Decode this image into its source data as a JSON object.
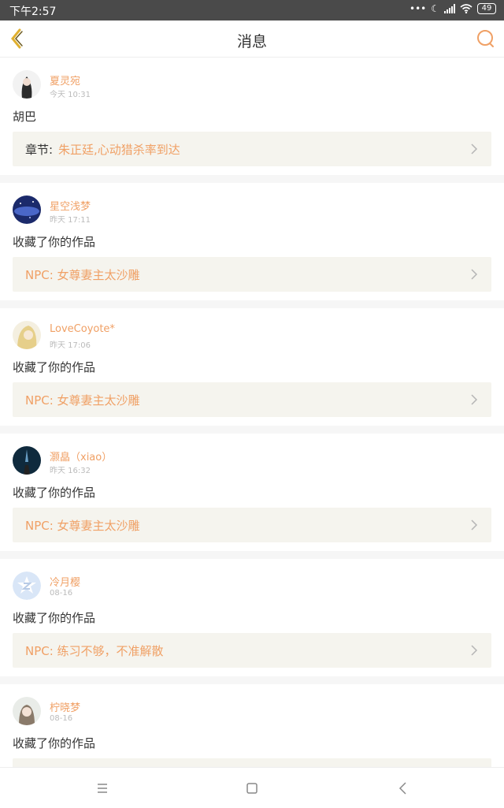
{
  "status_bar": {
    "time": "下午2:57",
    "battery": "49"
  },
  "header": {
    "title": "消息",
    "back_icon": "back-chevron-icon",
    "search_icon": "search-icon"
  },
  "colors": {
    "accent": "#f0a065",
    "text": "#333333",
    "muted": "#bbbbbb",
    "link_bg": "#f5f4ee",
    "status_bar": "#4a4a4a"
  },
  "messages": [
    {
      "user": "夏灵宛",
      "time": "今天 10:31",
      "text": "胡巴",
      "link_prefix": "章节:",
      "link_title": "朱正廷,心动猎杀率到达"
    },
    {
      "user": "星空浅梦",
      "time": "昨天 17:11",
      "text": "收藏了你的作品",
      "link_prefix": "",
      "link_title": "NPC: 女尊妻主太沙雕"
    },
    {
      "user": "LoveCoyote*",
      "time": "昨天 17:06",
      "text": "收藏了你的作品",
      "link_prefix": "",
      "link_title": "NPC: 女尊妻主太沙雕"
    },
    {
      "user": "灏皛（xiao）",
      "time": "昨天 16:32",
      "text": "收藏了你的作品",
      "link_prefix": "",
      "link_title": "NPC: 女尊妻主太沙雕"
    },
    {
      "user": "冷月樱",
      "time": "08-16",
      "text": "收藏了你的作品",
      "link_prefix": "",
      "link_title": "NPC: 练习不够，不准解散"
    },
    {
      "user": "柠晓梦",
      "time": "08-16",
      "text": "收藏了你的作品"
    }
  ],
  "nav": {
    "menu_icon": "menu-icon",
    "home_icon": "home-square-icon",
    "back_icon": "nav-back-icon"
  }
}
